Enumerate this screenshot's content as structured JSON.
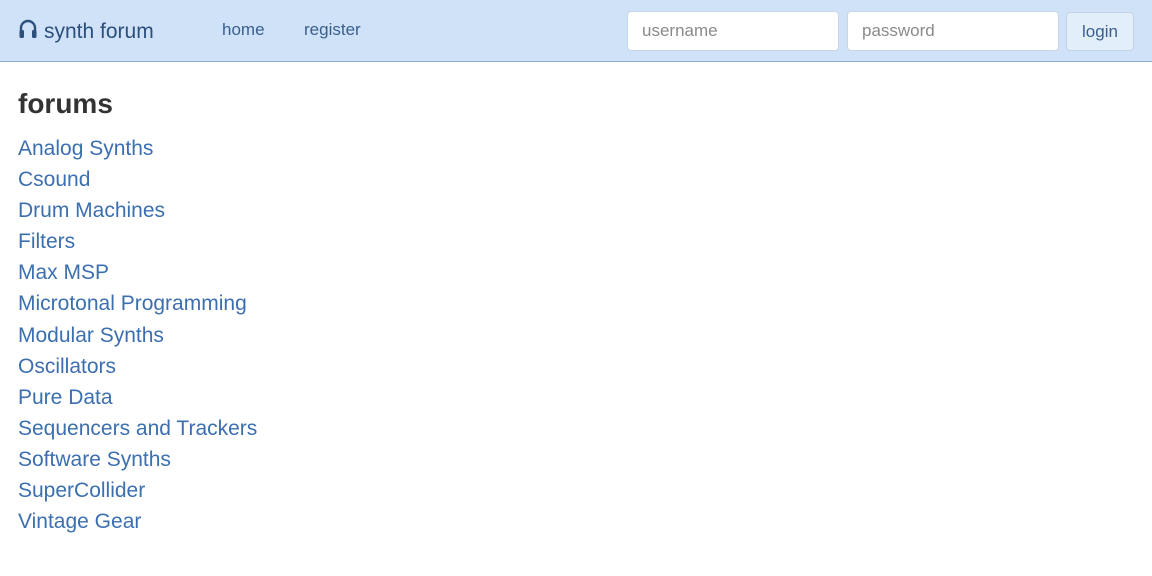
{
  "navbar": {
    "brand_label": "synth forum",
    "brand_icon": "headphones-icon",
    "links": [
      {
        "label": "home"
      },
      {
        "label": "register"
      }
    ],
    "username_placeholder": "username",
    "password_placeholder": "password",
    "login_label": "login",
    "colors": {
      "background": "#cfe2f8",
      "link": "#3a5f8e"
    }
  },
  "main": {
    "heading": "forums",
    "forums": [
      {
        "label": "Analog Synths"
      },
      {
        "label": "Csound"
      },
      {
        "label": "Drum Machines"
      },
      {
        "label": "Filters"
      },
      {
        "label": "Max MSP"
      },
      {
        "label": "Microtonal Programming"
      },
      {
        "label": "Modular Synths"
      },
      {
        "label": "Oscillators"
      },
      {
        "label": "Pure Data"
      },
      {
        "label": "Sequencers and Trackers"
      },
      {
        "label": "Software Synths"
      },
      {
        "label": "SuperCollider"
      },
      {
        "label": "Vintage Gear"
      }
    ],
    "link_color": "#3c6fb0"
  }
}
